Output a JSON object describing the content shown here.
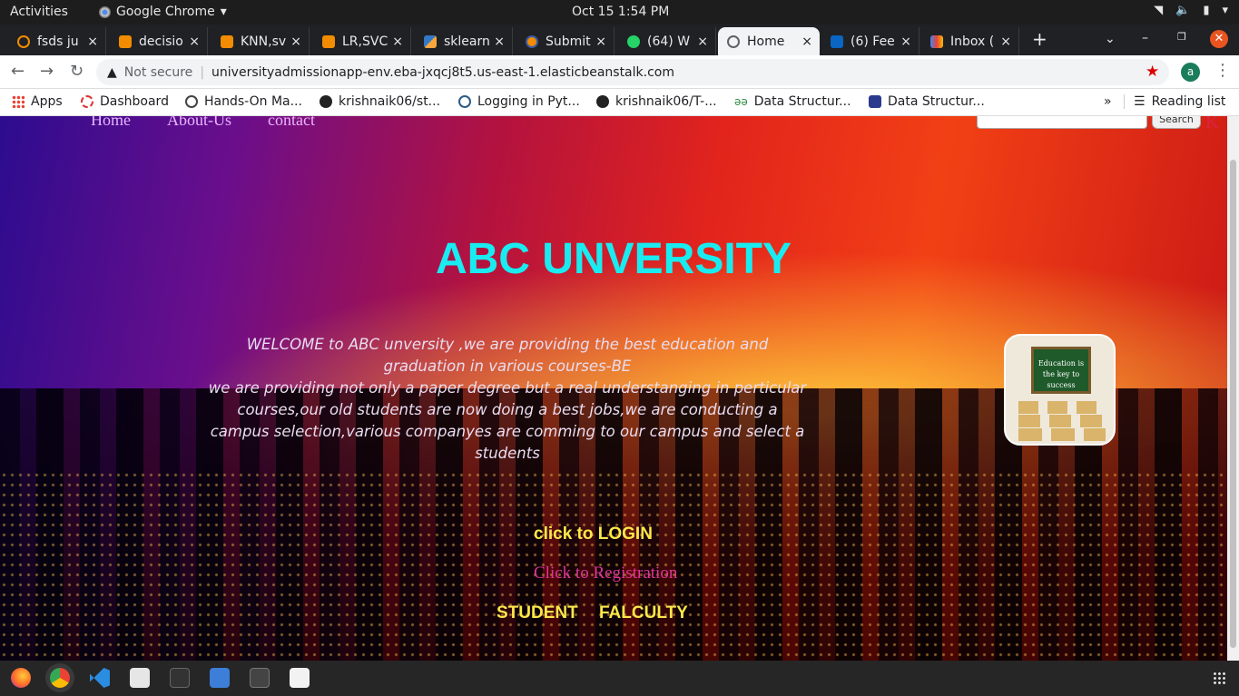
{
  "system_bar": {
    "activities": "Activities",
    "app_name": "Google Chrome",
    "clock": "Oct 15   1:54 PM"
  },
  "tabs": [
    {
      "label": "fsds ju",
      "color": "#f28c00"
    },
    {
      "label": "decisio",
      "color": "#f28c00"
    },
    {
      "label": "KNN,sv",
      "color": "#f28c00"
    },
    {
      "label": "LR,SVC",
      "color": "#f28c00"
    },
    {
      "label": "sklearn",
      "color": "#3478c6"
    },
    {
      "label": "Submit",
      "color": "#f28c00"
    },
    {
      "label": "(64) W",
      "color": "#25d366"
    },
    {
      "label": "Home",
      "color": "#5f6368"
    },
    {
      "label": "(6) Fee",
      "color": "#0a66c2"
    },
    {
      "label": "Inbox (",
      "color": "#ea4335"
    }
  ],
  "omnibox": {
    "security": "Not secure",
    "url": "universityadmissionapp-env.eba-jxqcj8t5.us-east-1.elasticbeanstalk.com",
    "profile_initial": "a"
  },
  "bookmarks": [
    {
      "label": "Apps"
    },
    {
      "label": "Dashboard"
    },
    {
      "label": "Hands-On Ma..."
    },
    {
      "label": "krishnaik06/st..."
    },
    {
      "label": "Logging in Pyt..."
    },
    {
      "label": "krishnaik06/T-..."
    },
    {
      "label": "Data Structur..."
    },
    {
      "label": "Data Structur..."
    }
  ],
  "reading_list": "Reading list",
  "site": {
    "nav": [
      "Home",
      "About-Us",
      "contact"
    ],
    "search_button": "Search",
    "title": "ABC UNVERSITY",
    "welcome_lines": [
      "WELCOME to ABC unversity ,we are providing the best education and graduation in various courses-BE",
      "we are providing not only a paper degree but a real understanging in perticular courses,our old students are now doing a best jobs,we are conducting a campus selection,various companyes are comming to our campus and select a students"
    ],
    "image_caption": "Education is the key to success",
    "login_link": "click to LOGIN",
    "registration_link": "Click to Registration",
    "student_link": "STUDENT",
    "faculty_link": "FALCULTY"
  }
}
